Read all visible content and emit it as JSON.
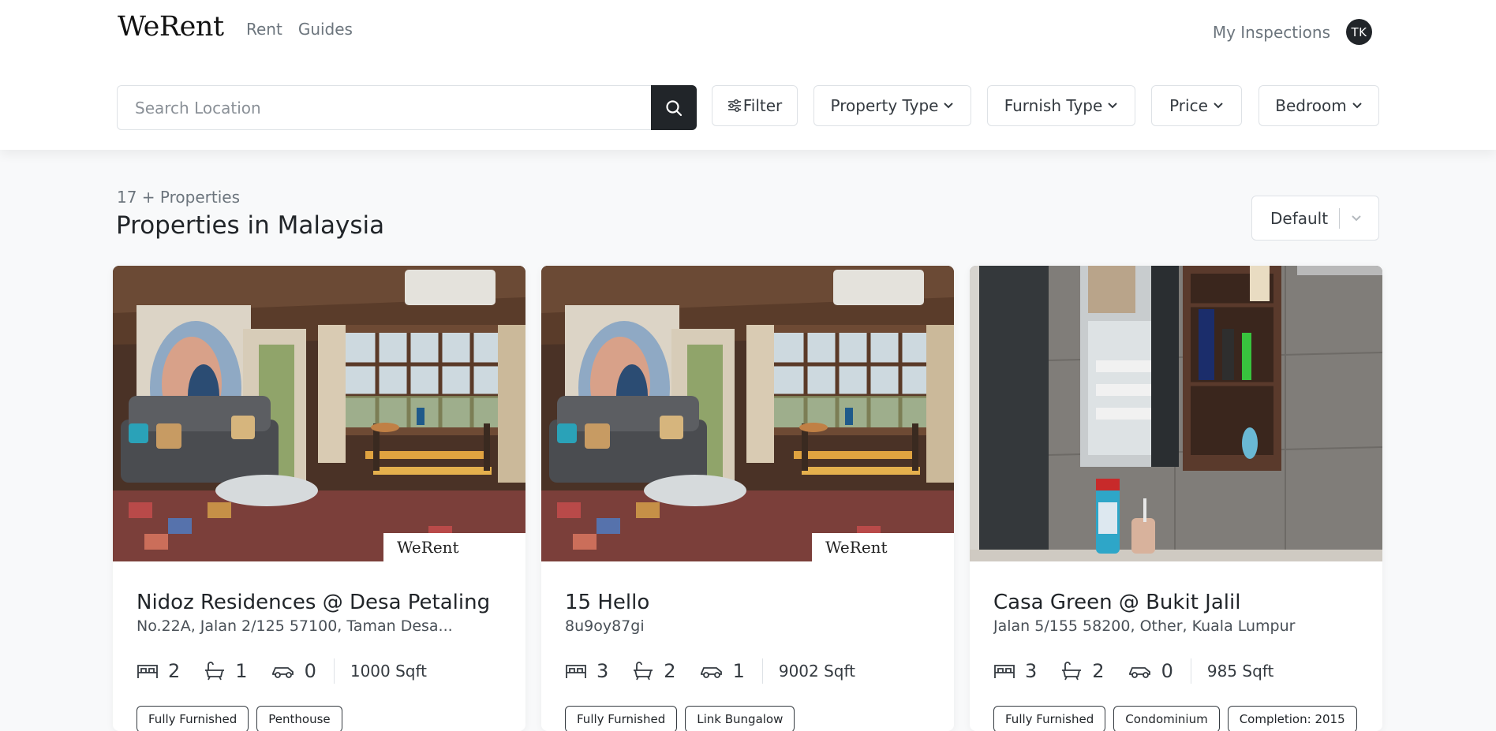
{
  "header": {
    "logo": "WeRent",
    "nav": [
      "Rent",
      "Guides"
    ],
    "my_inspections": "My Inspections",
    "avatar_initials": "TK"
  },
  "search": {
    "placeholder": "Search Location",
    "filter_label": "Filter",
    "dropdowns": [
      "Property Type",
      "Furnish Type",
      "Price",
      "Bedroom"
    ]
  },
  "listing": {
    "count_text": "17 + Properties",
    "title": "Properties in Malaysia",
    "sort_value": "Default"
  },
  "cards": [
    {
      "title": "Nidoz Residences @ Desa Petaling",
      "address": "No.22A, Jalan 2/125 57100, Taman Desa...",
      "bedrooms": "2",
      "bathrooms": "1",
      "parking": "0",
      "size": "1000 Sqft",
      "tags": [
        "Fully Furnished",
        "Penthouse"
      ],
      "watermark": "WeRent",
      "image": "living-room-photo"
    },
    {
      "title": "15 Hello",
      "address": "8u9oy87gi",
      "bedrooms": "3",
      "bathrooms": "2",
      "parking": "1",
      "size": "9002 Sqft",
      "tags": [
        "Fully Furnished",
        "Link Bungalow"
      ],
      "watermark": "WeRent",
      "image": "living-room-photo"
    },
    {
      "title": "Casa Green @ Bukit Jalil",
      "address": "Jalan 5/155 58200, Other, Kuala Lumpur",
      "bedrooms": "3",
      "bathrooms": "2",
      "parking": "0",
      "size": "985 Sqft",
      "tags": [
        "Fully Furnished",
        "Condominium",
        "Completion: 2015"
      ],
      "watermark": "",
      "image": "bathroom-photo"
    }
  ],
  "colors": {
    "dark": "#212529",
    "muted": "#6c757d",
    "border": "#dee2e6",
    "page_bg": "#f8f9fa"
  }
}
